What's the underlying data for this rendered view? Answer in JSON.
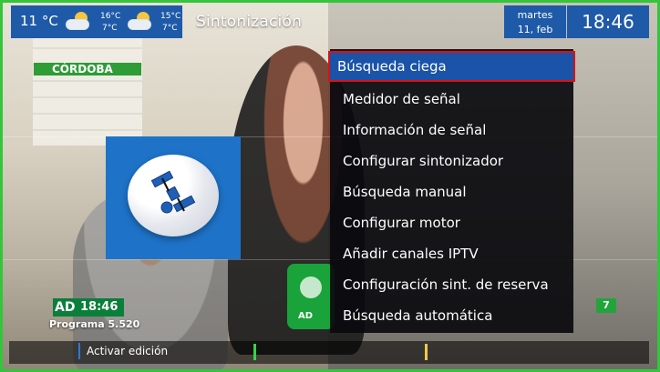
{
  "topbar": {
    "current_temp": "11 °C",
    "forecast_1": {
      "hi": "16°C",
      "lo": "7°C",
      "icon": "partly-cloudy-icon"
    },
    "forecast_2": {
      "hi": "15°C",
      "lo": "7°C",
      "icon": "partly-cloudy-icon"
    },
    "title": "Sintonización",
    "date": {
      "weekday": "martes",
      "daymonth": "11, feb"
    },
    "time": "18:46"
  },
  "scene": {
    "region_label": "CÓRDOBA",
    "ad_time": "18:46",
    "ad_brand": "AD",
    "program": "Programa 5.520",
    "channel_number": "7"
  },
  "menu": {
    "items": [
      "Búsqueda ciega",
      "Medidor de señal",
      "Información de señal",
      "Configurar sintonizador",
      "Búsqueda manual",
      "Configurar motor",
      "Añadir canales IPTV",
      "Configuración sint. de reserva",
      "Búsqueda automática"
    ],
    "selected_index": 0
  },
  "bottombar": {
    "edit_hint": "Activar edición"
  },
  "colors": {
    "accent_blue": "#1e5aa8",
    "selection_outline": "#d11111",
    "green_frame": "#34c53a"
  }
}
